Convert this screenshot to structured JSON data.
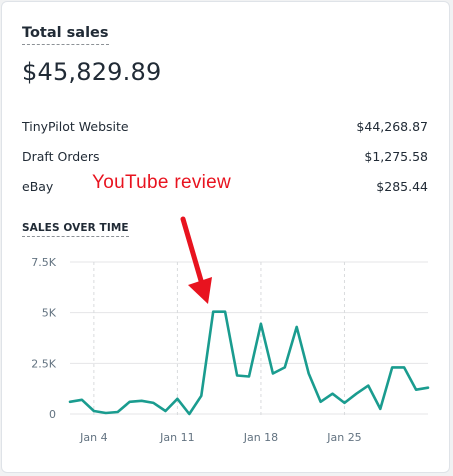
{
  "card": {
    "title": "Total sales",
    "total": "$45,829.89"
  },
  "breakdown": [
    {
      "label": "TinyPilot Website",
      "value": "$44,268.87"
    },
    {
      "label": "Draft Orders",
      "value": "$1,275.58"
    },
    {
      "label": "eBay",
      "value": "$285.44"
    }
  ],
  "annotation": {
    "text": "YouTube review",
    "color": "#e8131f"
  },
  "chart_section_title": "SALES OVER TIME",
  "chart_data": {
    "type": "line",
    "y_ticks": [
      "7.5K",
      "5K",
      "2.5K",
      "0"
    ],
    "x_ticks": [
      "Jan 4",
      "Jan 11",
      "Jan 18",
      "Jan 25"
    ],
    "ylim": [
      0,
      7500
    ],
    "line_color": "#1a9c8f",
    "grid": true,
    "series": [
      {
        "values": [
          600,
          700,
          150,
          50,
          100,
          600,
          650,
          550,
          150,
          750,
          0,
          900,
          5050,
          5050,
          1900,
          1850,
          4450,
          2000,
          2300,
          4300,
          2000,
          600,
          1000,
          550,
          1000,
          1400,
          250,
          2300,
          2300,
          1200,
          1300
        ]
      }
    ]
  }
}
